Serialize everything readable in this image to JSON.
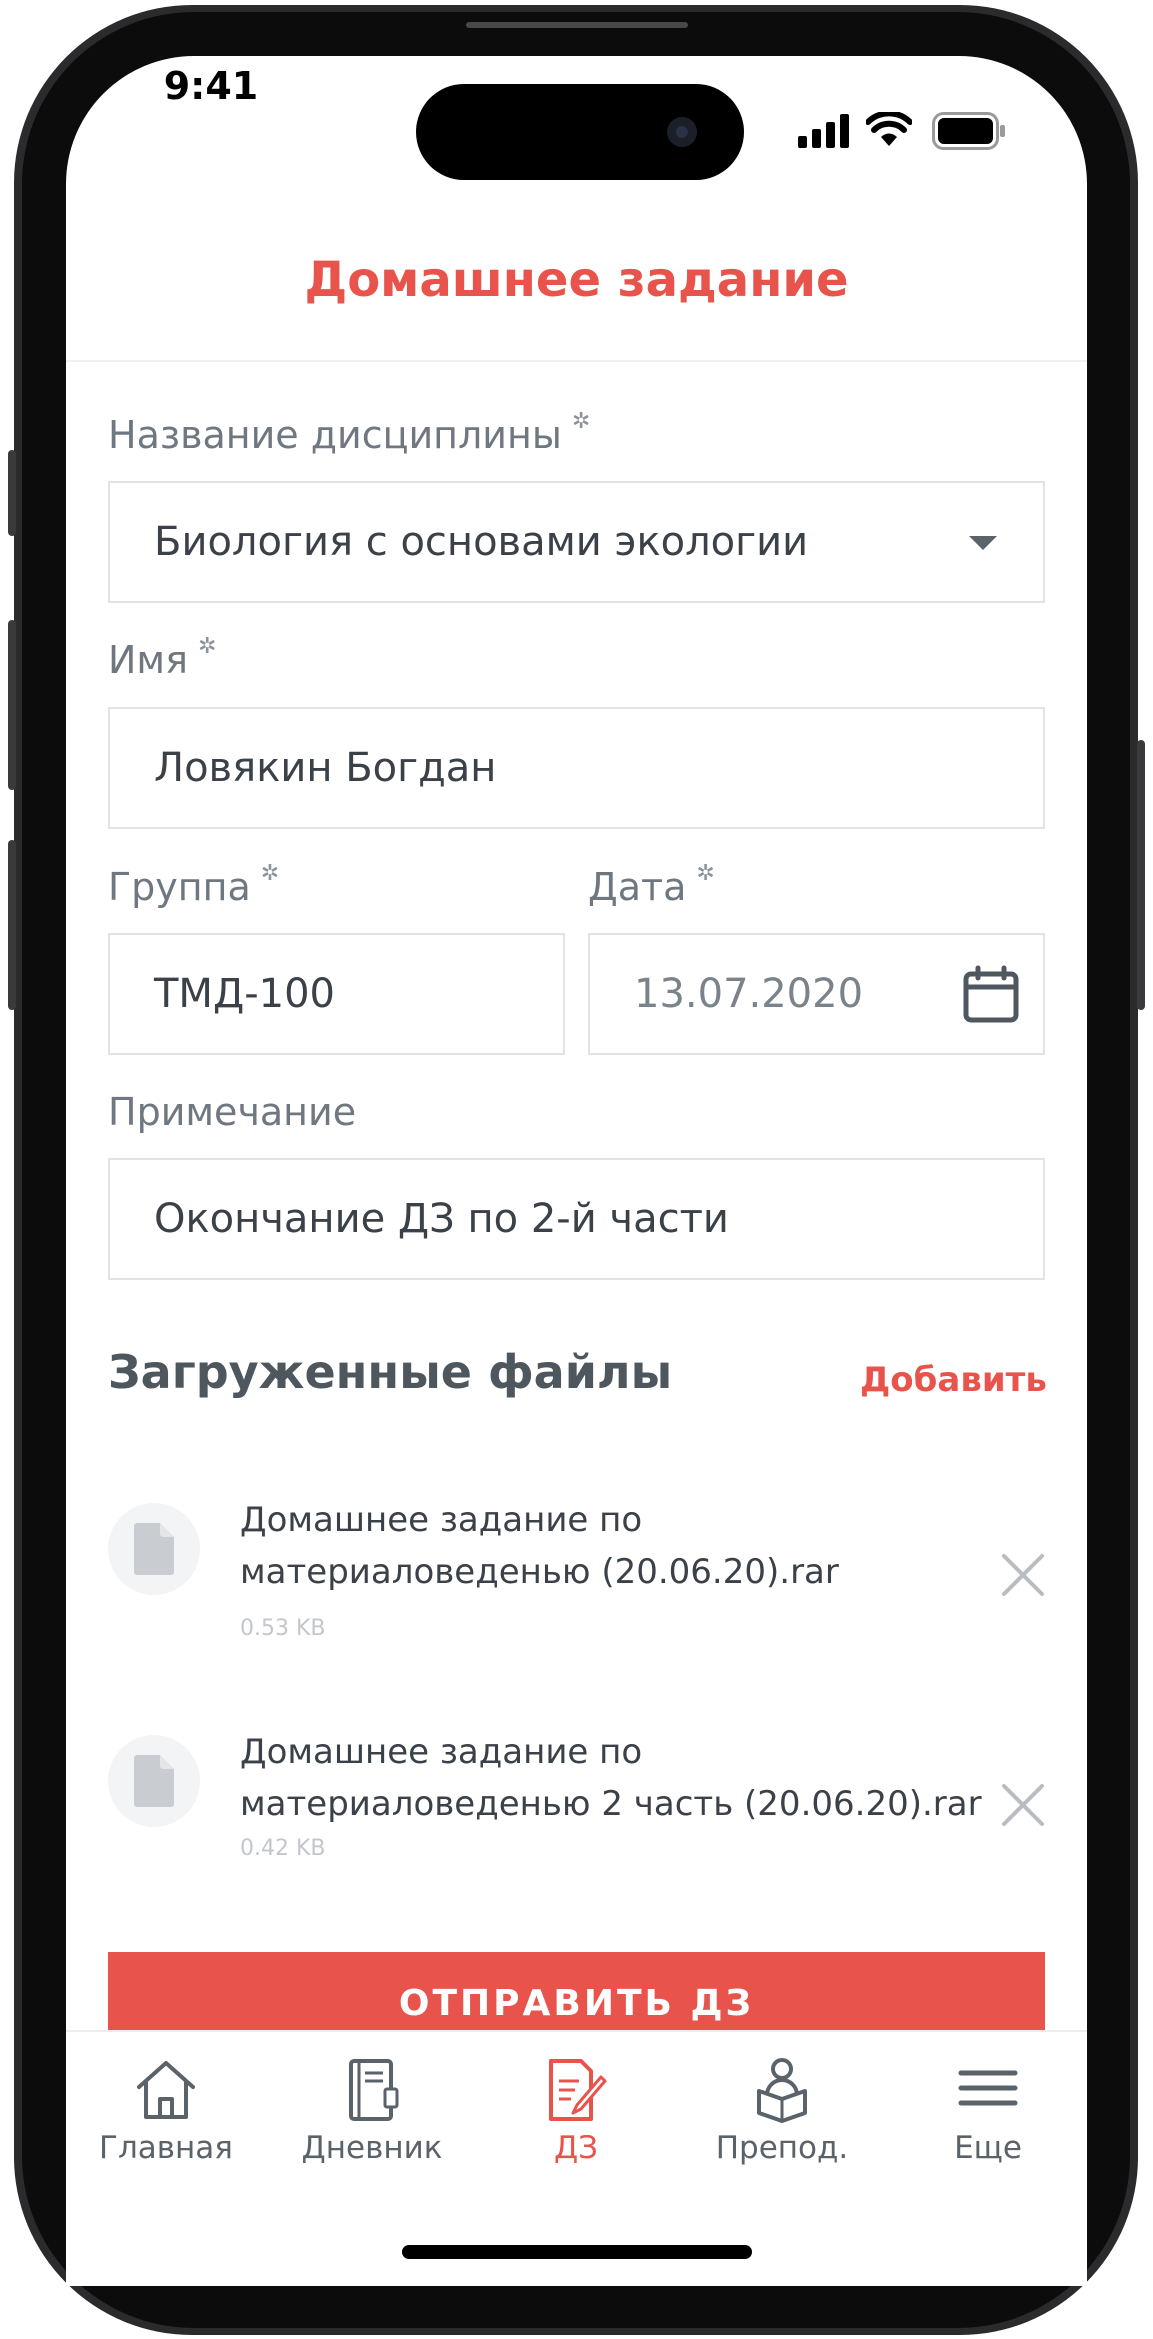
{
  "status_bar": {
    "time": "9:41"
  },
  "header": {
    "title": "Домашнее задание"
  },
  "form": {
    "discipline": {
      "label": "Название дисциплины",
      "value": "Биология с основами экологии"
    },
    "name": {
      "label": "Имя",
      "value": "Ловякин Богдан"
    },
    "group": {
      "label": "Группа",
      "value": "ТМД-100"
    },
    "date": {
      "label": "Дата",
      "value": "13.07.2020"
    },
    "note": {
      "label": "Примечание",
      "value": "Окончание ДЗ по 2-й части"
    }
  },
  "files_section": {
    "title": "Загруженные файлы",
    "add_label": "Добавить",
    "files": [
      {
        "name_line1": "Домашнее задание по",
        "name_line2": "материаловеденью (20.06.20).rar",
        "size": "0.53 KB"
      },
      {
        "name_line1": "Домашнее задание по",
        "name_line2": "материаловеденью 2 часть (20.06.20).rar",
        "size": "0.42 KB"
      }
    ]
  },
  "submit_label": "ОТПРАВИТЬ ДЗ",
  "tabbar": {
    "tabs": [
      {
        "label": "Главная",
        "icon": "home-icon",
        "active": false
      },
      {
        "label": "Дневник",
        "icon": "diary-icon",
        "active": false
      },
      {
        "label": "ДЗ",
        "icon": "homework-icon",
        "active": true
      },
      {
        "label": "Препод.",
        "icon": "teacher-icon",
        "active": false
      },
      {
        "label": "Еще",
        "icon": "menu-icon",
        "active": false
      }
    ]
  },
  "colors": {
    "accent": "#E8544C",
    "text": "#3B4148",
    "label": "#6F7780",
    "border": "#E1E3E6"
  }
}
